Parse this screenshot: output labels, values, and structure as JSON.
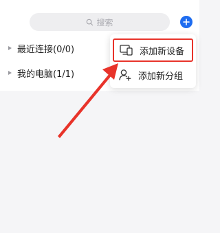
{
  "search": {
    "placeholder": "搜索"
  },
  "groups": [
    {
      "label": "最近连接(0/0)"
    },
    {
      "label": "我的电脑(1/1)"
    }
  ],
  "menu": {
    "items": [
      {
        "label": "添加新设备",
        "icon": "devices-icon"
      },
      {
        "label": "添加新分组",
        "icon": "add-person-icon"
      }
    ]
  },
  "colors": {
    "accent": "#1e6cf0",
    "highlight": "#e8332a"
  }
}
